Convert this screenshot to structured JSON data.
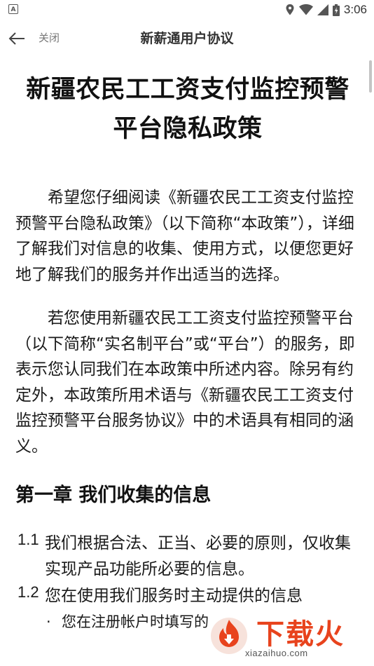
{
  "status_bar": {
    "notification_icon_label": "A",
    "time": "3:06"
  },
  "app_bar": {
    "close_label": "关闭",
    "title": "新薪通用户协议"
  },
  "document": {
    "title_line1": "新疆农民工工资支付监控预警",
    "title_line2": "平台隐私政策",
    "paragraphs": [
      "希望您仔细阅读《新疆农民工工资支付监控预警平台隐私政策》（以下简称“本政策”），详细了解我们对信息的收集、使用方式，以便您更好地了解我们的服务并作出适当的选择。",
      "若您使用新疆农民工工资支付监控预警平台（以下简称“实名制平台”或“平台”）的服务，即表示您认同我们在本政策中所述内容。除另有约定外，本政策所用术语与《新疆农民工工资支付监控预警平台服务协议》中的术语具有相同的涵义。"
    ],
    "chapter1_title": "第一章 我们收集的信息",
    "clauses": [
      {
        "num": "1.1",
        "text": "我们根据合法、正当、必要的原则，仅收集实现产品功能所必要的信息。"
      },
      {
        "num": "1.2",
        "text": "您在使用我们服务时主动提供的信息"
      }
    ],
    "bullet": {
      "dot": "·",
      "text": "您在注册帐户时填写的"
    }
  },
  "watermark": {
    "brand": "下载火",
    "url": "xiazaihuo.com"
  },
  "colors": {
    "watermark_accent": "#e8431d"
  }
}
